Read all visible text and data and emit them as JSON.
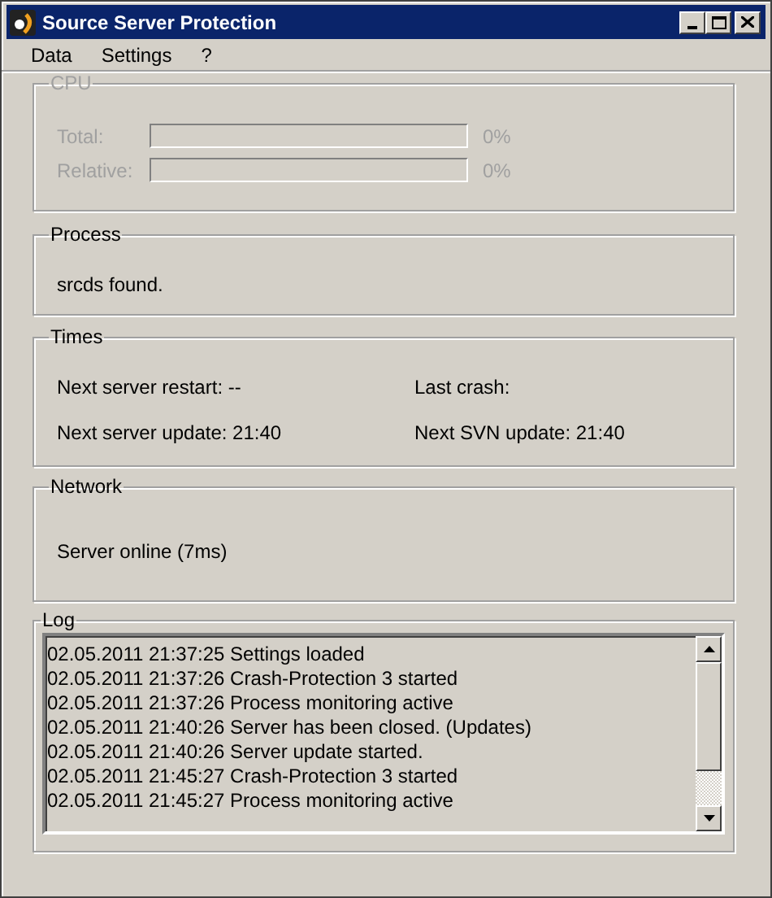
{
  "window": {
    "title": "Source Server Protection"
  },
  "menu": [
    "Data",
    "Settings",
    "?"
  ],
  "cpu": {
    "title": "CPU",
    "disabled": true,
    "meters": [
      {
        "label": "Total:",
        "level": 0,
        "reading": "0%"
      },
      {
        "label": "Relative:",
        "level": 0,
        "reading": "0%"
      }
    ]
  },
  "process": {
    "title": "Process",
    "status": "srcds found."
  },
  "times": {
    "title": "Times",
    "items": [
      "Next server restart: --",
      "Last crash:",
      "Next server update: 21:40",
      "Next SVN update: 21:40"
    ]
  },
  "network": {
    "title": "Network",
    "status": "Server online (7ms)"
  },
  "log": {
    "title": "Log",
    "entries": [
      "02.05.2011 21:37:25 Settings loaded",
      "02.05.2011 21:37:26 Crash-Protection 3 started",
      "02.05.2011 21:37:26 Process monitoring active",
      "02.05.2011 21:40:26 Server has been closed. (Updates)",
      "02.05.2011 21:40:26 Server update started.",
      "02.05.2011 21:45:27 Crash-Protection 3 started",
      "02.05.2011 21:45:27 Process monitoring active"
    ]
  }
}
